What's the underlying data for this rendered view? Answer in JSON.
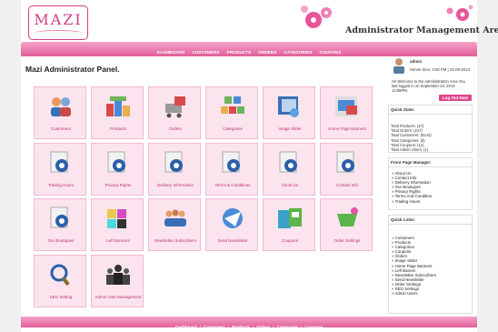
{
  "brand": {
    "logo": "MAZI",
    "title": "Administrator Management Area",
    "accent": "#d13d85"
  },
  "nav": [
    "DASHBOARD",
    "CUSTOMERS",
    "PRODUCTS",
    "ORDERS",
    "CATEGORIES",
    "COUPONS"
  ],
  "main": {
    "title": "Mazi Administrator Panel.",
    "tiles": [
      {
        "label": "Customers",
        "icon": "customers-icon"
      },
      {
        "label": "Products",
        "icon": "products-icon"
      },
      {
        "label": "Orders",
        "icon": "orders-icon"
      },
      {
        "label": "Categories",
        "icon": "categories-icon"
      },
      {
        "label": "Image Slider",
        "icon": "image-slider-icon"
      },
      {
        "label": "Home Page Banners",
        "icon": "banners-icon"
      },
      {
        "label": "Trading Hours",
        "icon": "document-icon"
      },
      {
        "label": "Privacy Rights",
        "icon": "document-icon"
      },
      {
        "label": "Delivery Information",
        "icon": "document-icon"
      },
      {
        "label": "Terms & Conditions",
        "icon": "document-icon"
      },
      {
        "label": "About Us",
        "icon": "document-icon"
      },
      {
        "label": "Contact Info",
        "icon": "document-icon"
      },
      {
        "label": "Our Boutiques",
        "icon": "document-icon"
      },
      {
        "label": "Left Banners",
        "icon": "color-palette-icon"
      },
      {
        "label": "Newsletter Subscribers",
        "icon": "subscribers-icon"
      },
      {
        "label": "Send Newsletter",
        "icon": "send-newsletter-icon"
      },
      {
        "label": "Coupons",
        "icon": "coupons-icon"
      },
      {
        "label": "Order Settings",
        "icon": "order-settings-icon"
      },
      {
        "label": "SEO Setting",
        "icon": "seo-icon"
      },
      {
        "label": "Admin User Management",
        "icon": "admin-users-icon"
      }
    ]
  },
  "sidebar": {
    "admin_name": "admin",
    "server_time": "Server time: 3:00 PM | 22-09-2013",
    "welcome": "Hi! Welcome to the Administration Area.You last logged in on September 22, 2013 14:58PM.",
    "logout_label": "Log Out Now",
    "quick_state": {
      "heading": "Quick State:",
      "lines": [
        "Total Products: (47)",
        "Total Orders: (217)",
        "Total Customers: (6144)",
        "Total Categories: (8)",
        "Total Coupons: (12)",
        "Total Admin Users: (1)"
      ]
    },
    "front_page": {
      "heading": "Front Page Manager:",
      "links": [
        "» About Us",
        "» Contact Info",
        "» Delivery Information",
        "» Our Boutiques",
        "» Privacy Rights",
        "» Terms And Condition",
        "» Trading Hours"
      ]
    },
    "quick_links": {
      "heading": "Quick Links:",
      "links": [
        "» Customers",
        "» Products",
        "» Categories",
        "» Coupons",
        "» Orders",
        "» Image Slider",
        "» Home Page Banners",
        "» Left Banner",
        "» Newsletter Subscribers",
        "» Send Newsletter",
        "» Order Settings",
        "» SEO Settings",
        "» Admin Users"
      ]
    }
  },
  "footer": [
    "Dashboard",
    "Customers",
    "Products",
    "Orders",
    "Categories",
    "Coupons"
  ]
}
